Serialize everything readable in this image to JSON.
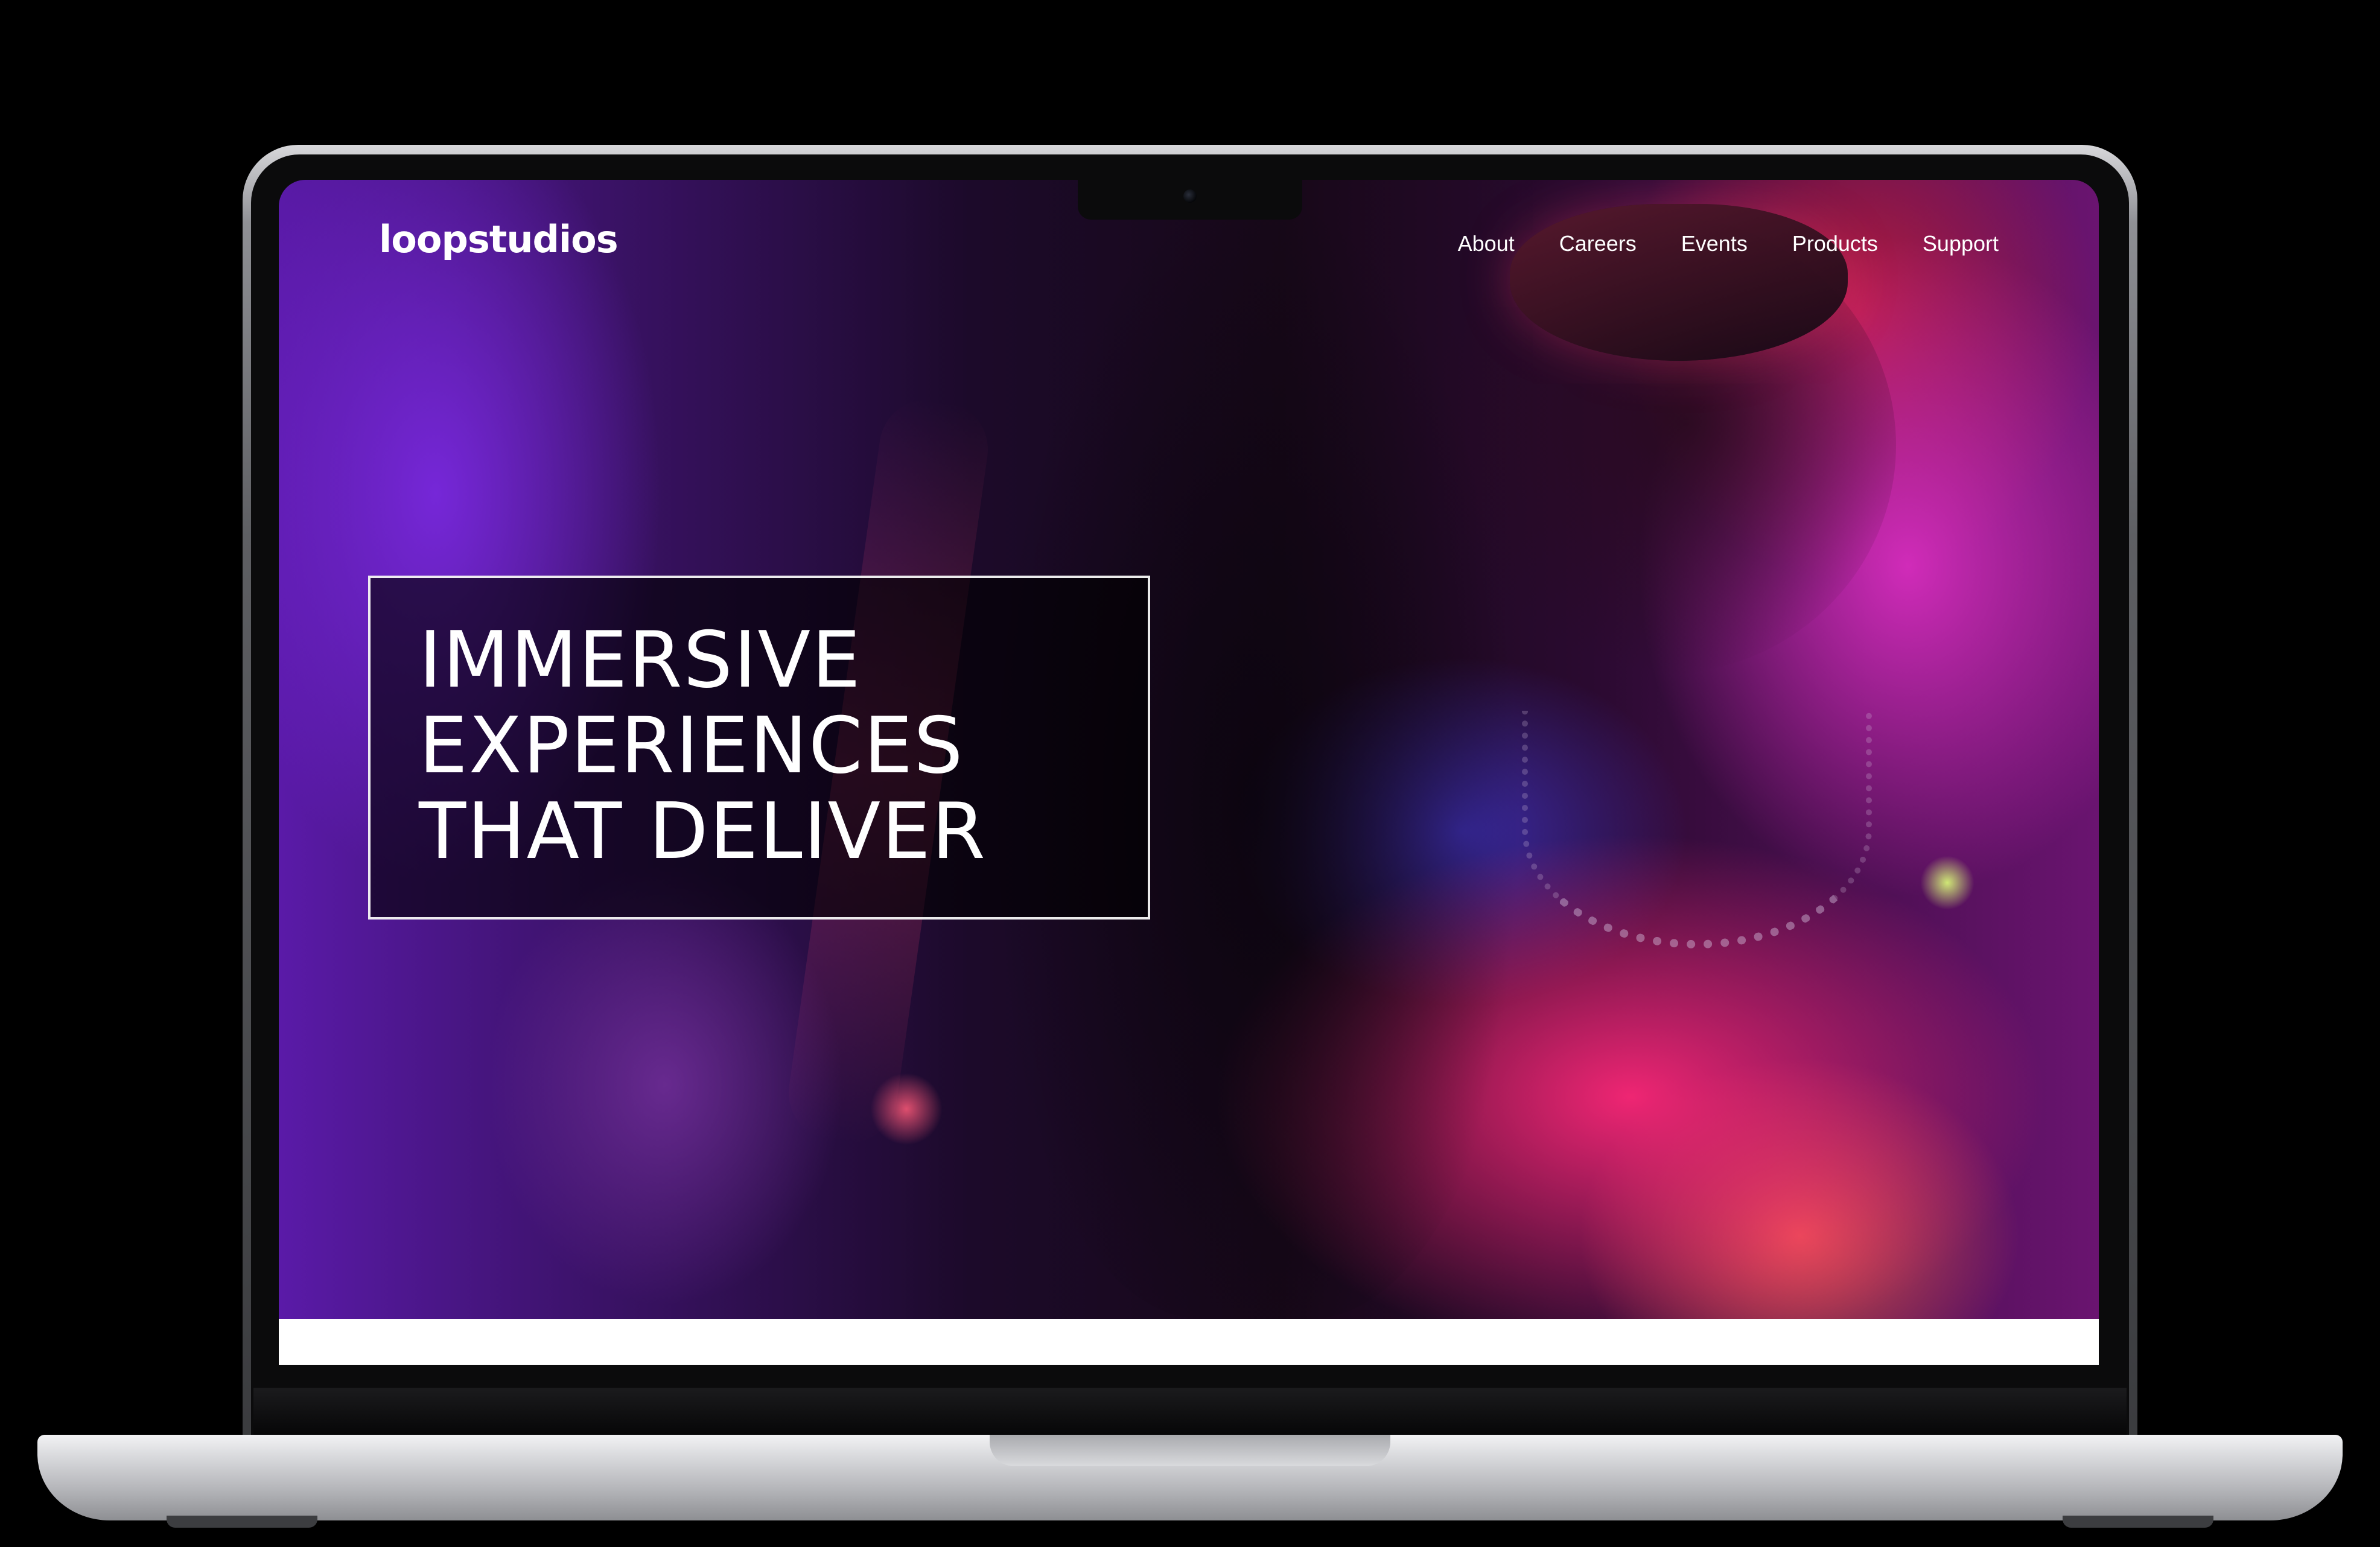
{
  "site": {
    "logo": "loopstudios"
  },
  "nav": {
    "items": [
      {
        "label": "About"
      },
      {
        "label": "Careers"
      },
      {
        "label": "Events"
      },
      {
        "label": "Products"
      },
      {
        "label": "Support"
      }
    ]
  },
  "hero": {
    "headline_lines": [
      "IMMERSIVE",
      "EXPERIENCES",
      "THAT DELIVER"
    ]
  },
  "colors": {
    "text": "#ffffff",
    "headline_box_border": "#ffffff",
    "hero_accent_magenta": "#d72dbe",
    "hero_accent_pink": "#ff2878",
    "hero_accent_violet": "#7828dc",
    "device_body": "#c9cacd",
    "bezel": "#0b0b0c"
  }
}
